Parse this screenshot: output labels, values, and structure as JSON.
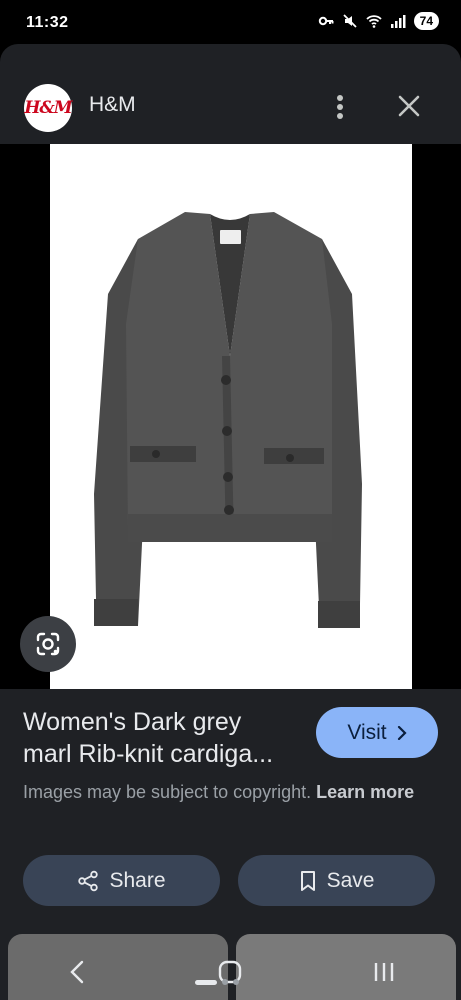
{
  "status_bar": {
    "time": "11:32",
    "battery": "74",
    "icons": [
      "key-icon",
      "mute-icon",
      "wifi-icon",
      "signal-icon"
    ]
  },
  "header": {
    "logo_text": "H&M",
    "site_name": "H&M",
    "more_icon": "more-vert-icon",
    "close_icon": "close-icon"
  },
  "image": {
    "alt": "Women's Dark grey marl Rib-knit cardigan",
    "lens_icon": "lens-icon"
  },
  "result": {
    "title_line1": "Women's Dark grey",
    "title_line2": "marl Rib-knit cardiga...",
    "visit_label": "Visit",
    "copyright_text": "Images may be subject to copyright.",
    "learn_more_label": "Learn more"
  },
  "actions": {
    "share_label": "Share",
    "save_label": "Save"
  },
  "nav": {
    "back_icon": "back-icon",
    "home_icon": "home-icon",
    "recents_icon": "recents-icon"
  },
  "colors": {
    "accent": "#8ab4f8",
    "sheet_bg": "#1f2125",
    "button_bg": "#394456",
    "brand_red": "#cc071e"
  }
}
